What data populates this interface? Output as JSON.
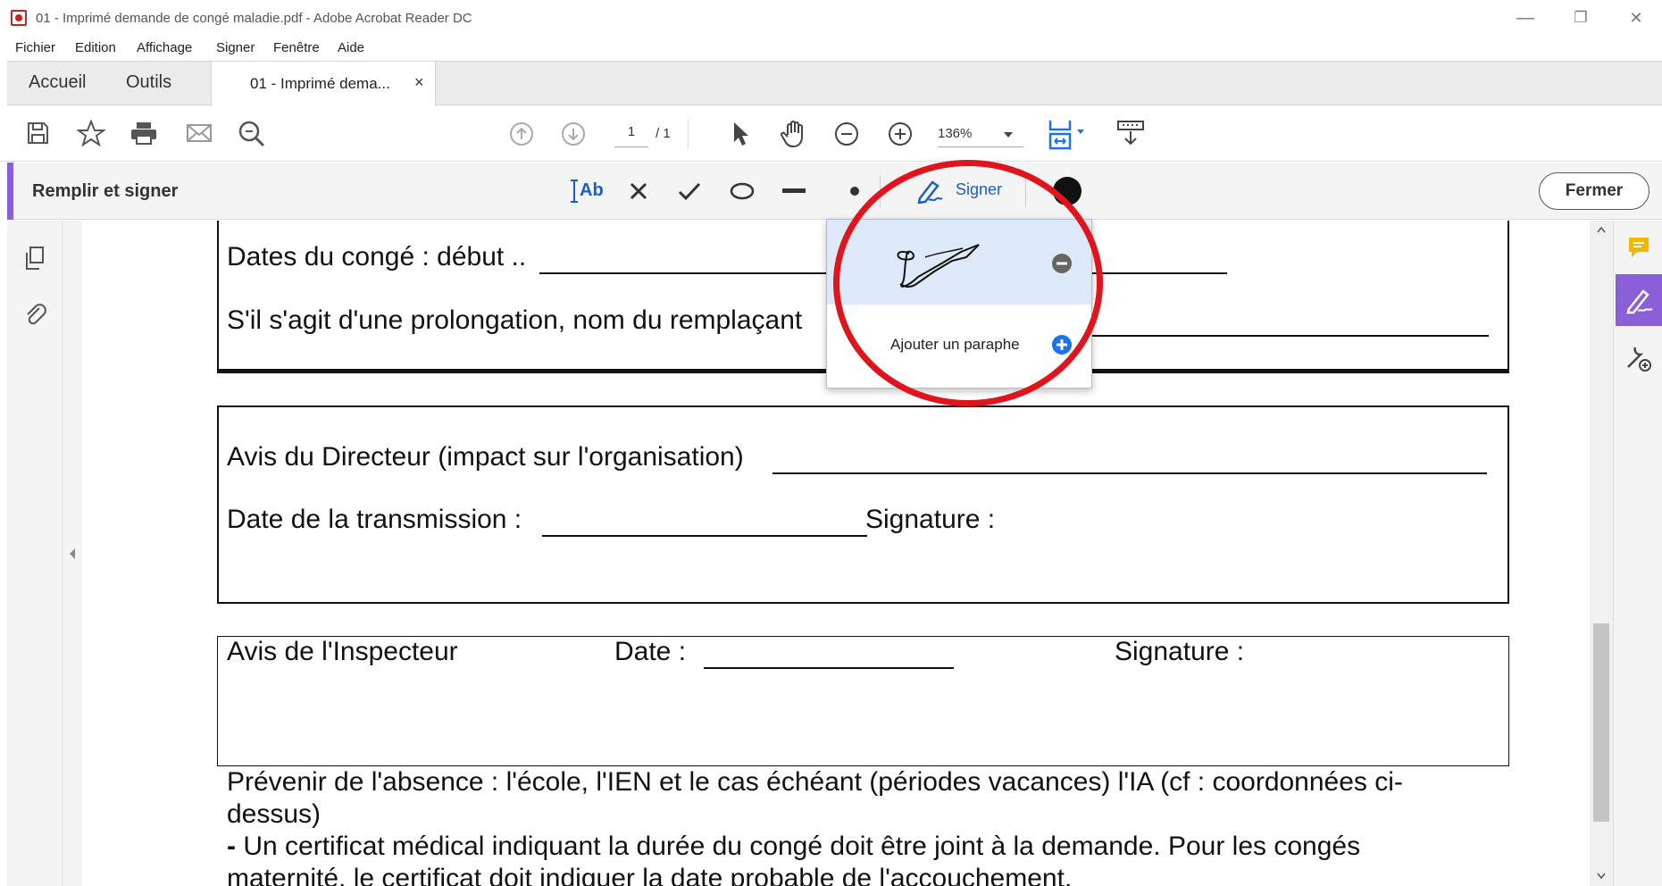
{
  "window": {
    "title": "01 - Imprimé demande de congé maladie.pdf - Adobe Acrobat Reader DC",
    "controls": {
      "minimize": "—",
      "restore": "❐",
      "close": "✕"
    }
  },
  "menu": [
    "Fichier",
    "Edition",
    "Affichage",
    "Signer",
    "Fenêtre",
    "Aide"
  ],
  "tabs": {
    "home": "Accueil",
    "tools": "Outils",
    "document": "01 - Imprimé dema...",
    "close": "×"
  },
  "toolbar": {
    "page_current": "1",
    "page_total": "/ 1",
    "zoom": "136%"
  },
  "fill_sign": {
    "title": "Remplir et signer",
    "text_tool": "Ab",
    "signer": "Signer",
    "close": "Fermer",
    "accent_color": "#8a5fd8"
  },
  "signer_menu": {
    "add_initials": "Ajouter un paraphe"
  },
  "document": {
    "leave_dates": "Dates du congé : début ..",
    "extension": "S'il s'agit d'une prolongation, nom du remplaçant",
    "director_opinion": "Avis du Directeur (impact sur l'organisation)",
    "transmission_date": "Date de la transmission :",
    "signature": "Signature :",
    "inspector_opinion": "Avis de l'Inspecteur",
    "date": "Date :",
    "signature2": "Signature :",
    "notice_bold": "Prévenir de l'absence :",
    "notice": " l'école, l'IEN et le cas échéant (périodes vacances) l'IA (cf : coordonnées ci-",
    "notice2": "dessus)",
    "bullet": "-",
    "certificate": " Un certificat médical indiquant la durée du congé doit être joint à la demande. Pour les congés",
    "maternity": "maternité, le certificat doit indiquer la date probable de l'accouchement."
  },
  "colors": {
    "highlight": "#e0141c",
    "selected_row": "#dde9f8",
    "add_button": "#1a73e8"
  }
}
